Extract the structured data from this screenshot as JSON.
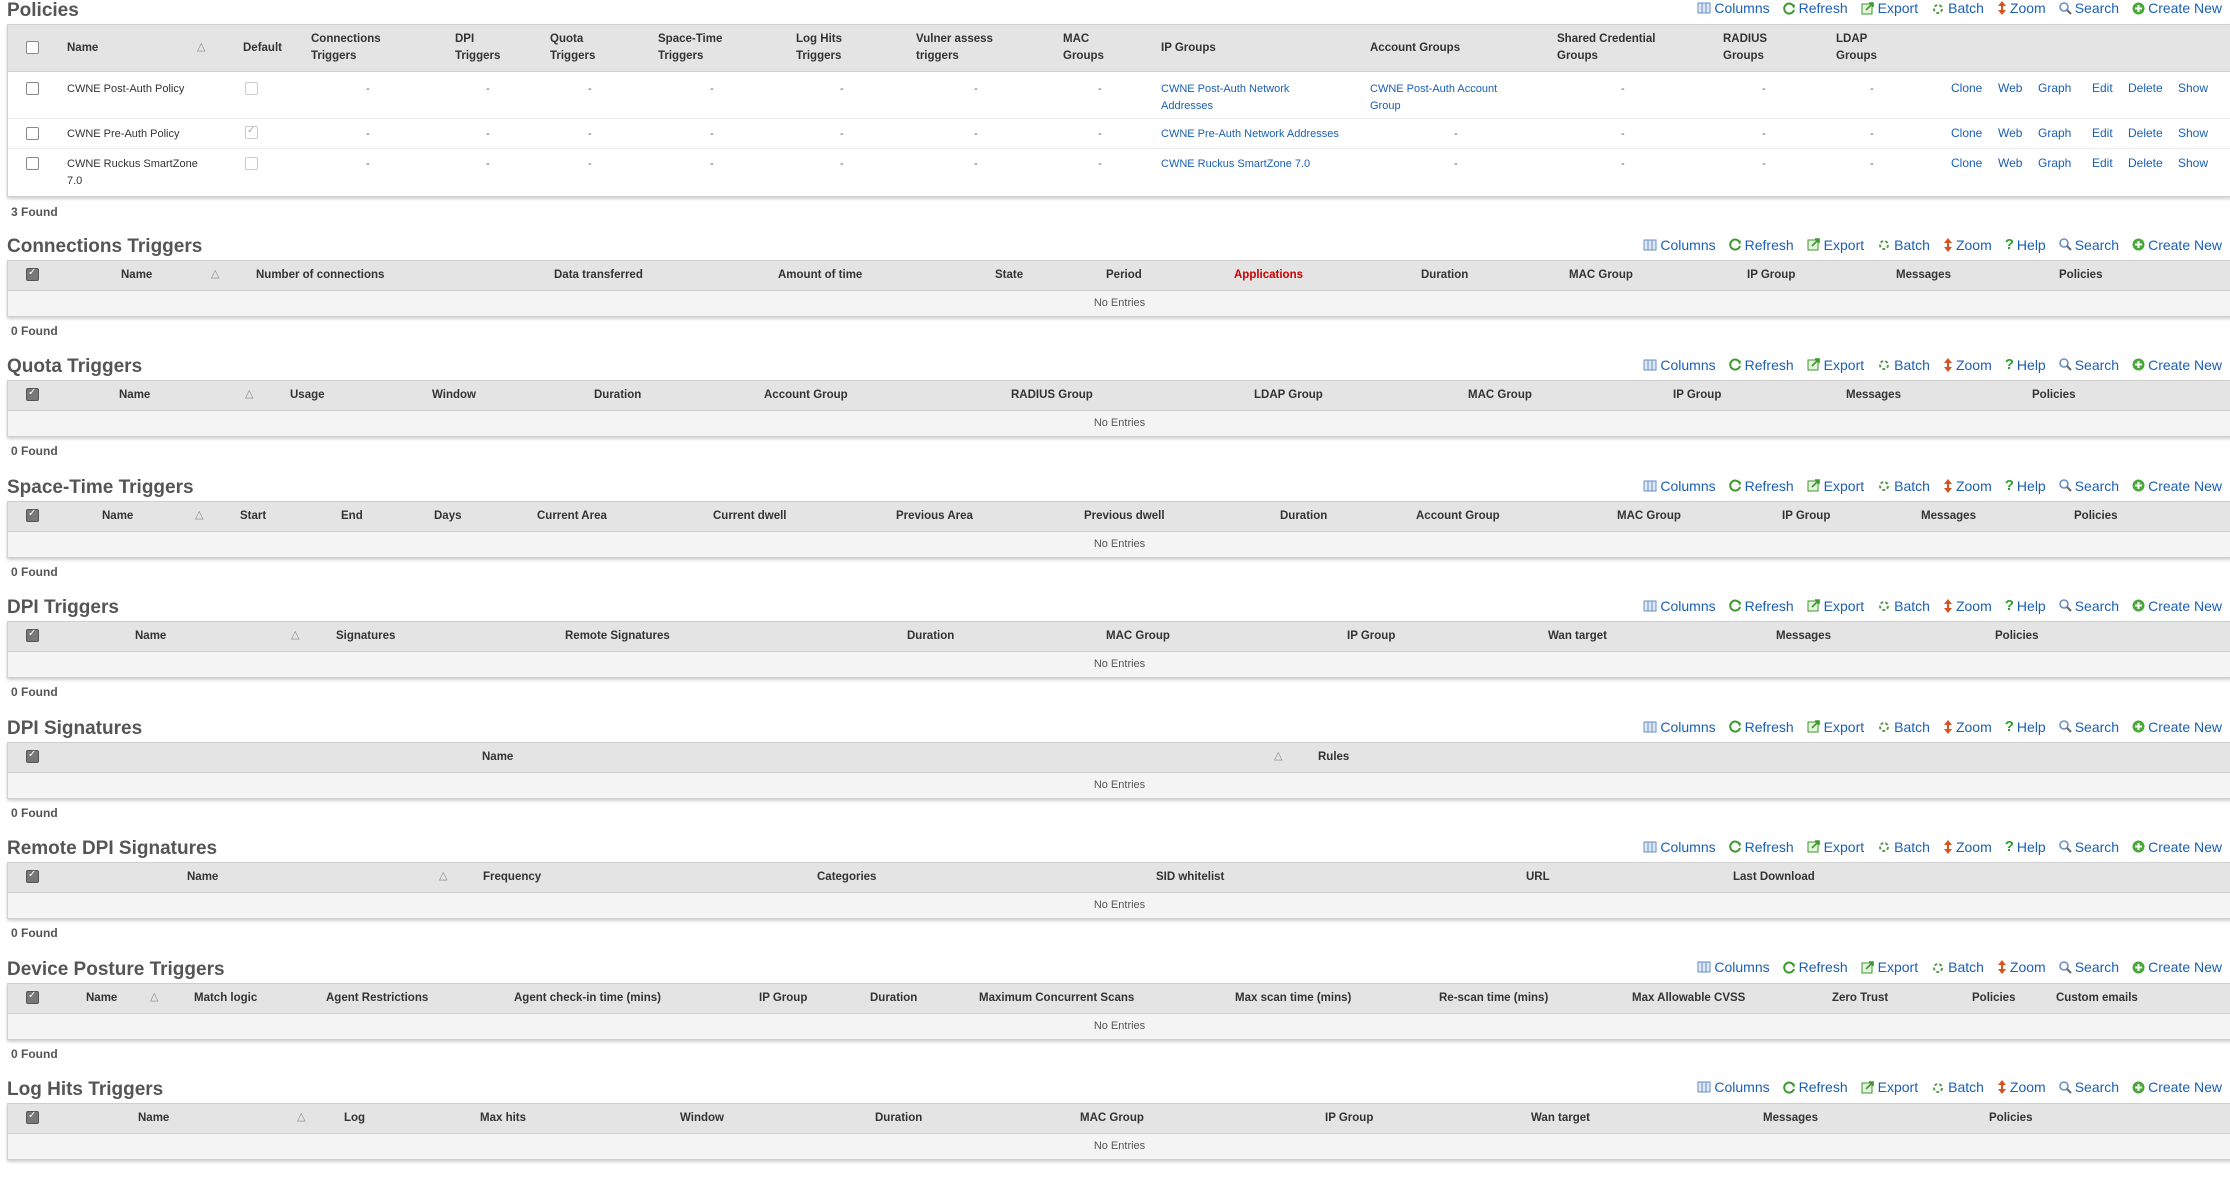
{
  "actions": {
    "columns": "Columns",
    "refresh": "Refresh",
    "export": "Export",
    "batch": "Batch",
    "zoom": "Zoom",
    "help": "Help",
    "search": "Search",
    "create_new": "Create New"
  },
  "colors": {
    "link": "#1a5fb4",
    "header_bg": "#e4e4e4",
    "highlight_header": "#cc0000"
  },
  "icons": [
    "columns-icon",
    "refresh-icon",
    "export-icon",
    "batch-icon",
    "zoom-icon",
    "help-icon",
    "search-icon",
    "create-new-icon"
  ],
  "policies": {
    "title": "Policies",
    "found": "3 Found",
    "headers": {
      "name": "Name",
      "default": "Default",
      "conn1": "Connections",
      "conn2": "Triggers",
      "dpi1": "DPI",
      "dpi2": "Triggers",
      "quota1": "Quota",
      "quota2": "Triggers",
      "st1": "Space-Time",
      "st2": "Triggers",
      "log1": "Log Hits",
      "log2": "Triggers",
      "vuln1": "Vulner assess",
      "vuln2": "triggers",
      "mac1": "MAC",
      "mac2": "Groups",
      "ipgroups": "IP Groups",
      "accountgroups": "Account Groups",
      "shared1": "Shared Credential",
      "shared2": "Groups",
      "radius1": "RADIUS",
      "radius2": "Groups",
      "ldap1": "LDAP",
      "ldap2": "Groups"
    },
    "row_actions": {
      "clone": "Clone",
      "web": "Web",
      "graph": "Graph",
      "edit": "Edit",
      "delete": "Delete",
      "show": "Show"
    },
    "rows": [
      {
        "name1": "CWNE Post-Auth Policy",
        "name2": "",
        "default": false,
        "conn": "-",
        "dpi": "-",
        "quota": "-",
        "st": "-",
        "log": "-",
        "vuln": "-",
        "mac": "-",
        "ip1": "CWNE Post-Auth Network",
        "ip2": "Addresses",
        "acct1": "CWNE Post-Auth Account",
        "acct2": "Group",
        "shared": "-",
        "radius": "-",
        "ldap": "-"
      },
      {
        "name1": "CWNE Pre-Auth Policy",
        "name2": "",
        "default": true,
        "conn": "-",
        "dpi": "-",
        "quota": "-",
        "st": "-",
        "log": "-",
        "vuln": "-",
        "mac": "-",
        "ip1": "CWNE Pre-Auth Network Addresses",
        "ip2": "",
        "acct1": "-",
        "acct2": "",
        "shared": "-",
        "radius": "-",
        "ldap": "-"
      },
      {
        "name1": "CWNE Ruckus SmartZone",
        "name2": "7.0",
        "default": false,
        "conn": "-",
        "dpi": "-",
        "quota": "-",
        "st": "-",
        "log": "-",
        "vuln": "-",
        "mac": "-",
        "ip1": "CWNE Ruckus SmartZone 7.0",
        "ip2": "",
        "acct1": "-",
        "acct2": "",
        "shared": "-",
        "radius": "-",
        "ldap": "-"
      }
    ]
  },
  "connections": {
    "title": "Connections Triggers",
    "found": "0 Found",
    "no_entries": "No Entries",
    "headers": [
      "Name",
      "Number of connections",
      "Data transferred",
      "Amount of time",
      "State",
      "Period",
      "Applications",
      "Duration",
      "MAC Group",
      "IP Group",
      "Messages",
      "Policies"
    ]
  },
  "quota": {
    "title": "Quota Triggers",
    "found": "0 Found",
    "no_entries": "No Entries",
    "headers": [
      "Name",
      "Usage",
      "Window",
      "Duration",
      "Account Group",
      "RADIUS Group",
      "LDAP Group",
      "MAC Group",
      "IP Group",
      "Messages",
      "Policies"
    ]
  },
  "spacetime": {
    "title": "Space-Time Triggers",
    "found": "0 Found",
    "no_entries": "No Entries",
    "headers": [
      "Name",
      "Start",
      "End",
      "Days",
      "Current Area",
      "Current dwell",
      "Previous Area",
      "Previous dwell",
      "Duration",
      "Account Group",
      "MAC Group",
      "IP Group",
      "Messages",
      "Policies"
    ]
  },
  "dpitriggers": {
    "title": "DPI Triggers",
    "found": "0 Found",
    "no_entries": "No Entries",
    "headers": [
      "Name",
      "Signatures",
      "Remote Signatures",
      "Duration",
      "MAC Group",
      "IP Group",
      "Wan target",
      "Messages",
      "Policies"
    ]
  },
  "dpisig": {
    "title": "DPI Signatures",
    "found": "0 Found",
    "no_entries": "No Entries",
    "headers": [
      "Name",
      "Rules"
    ]
  },
  "remotedpi": {
    "title": "Remote DPI Signatures",
    "found": "0 Found",
    "no_entries": "No Entries",
    "headers": [
      "Name",
      "Frequency",
      "Categories",
      "SID whitelist",
      "URL",
      "Last Download"
    ]
  },
  "posture": {
    "title": "Device Posture Triggers",
    "found": "0 Found",
    "no_entries": "No Entries",
    "headers": [
      "Name",
      "Match logic",
      "Agent Restrictions",
      "Agent check-in time (mins)",
      "IP Group",
      "Duration",
      "Maximum Concurrent Scans",
      "Max scan time (mins)",
      "Re-scan time (mins)",
      "Max Allowable CVSS",
      "Zero Trust",
      "Policies",
      "Custom emails"
    ]
  },
  "loghits": {
    "title": "Log Hits Triggers",
    "no_entries": "No Entries",
    "headers": [
      "Name",
      "Log",
      "Max hits",
      "Window",
      "Duration",
      "MAC Group",
      "IP Group",
      "Wan target",
      "Messages",
      "Policies"
    ]
  }
}
